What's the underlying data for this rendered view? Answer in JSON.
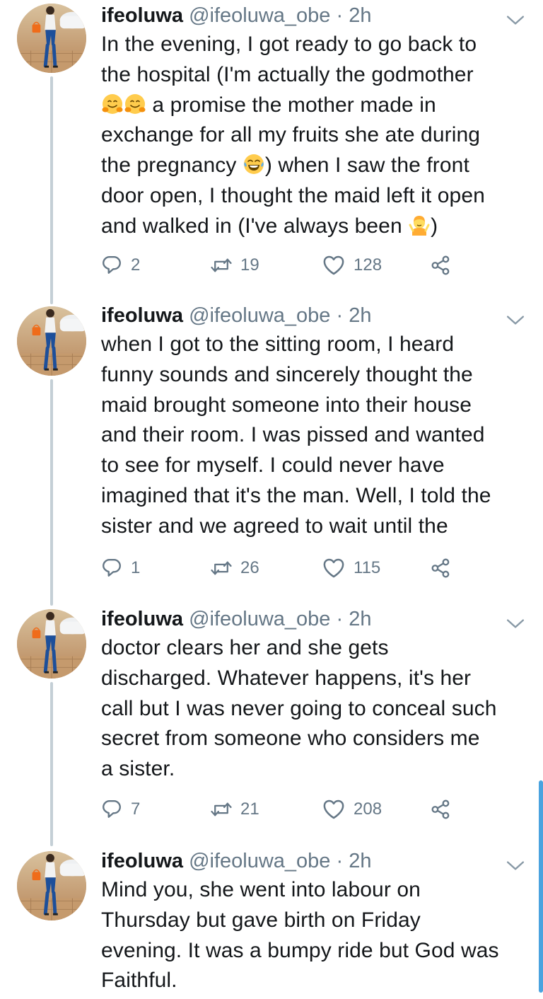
{
  "tweets": [
    {
      "name": "ifeoluwa",
      "handle": "@ifeoluwa_obe",
      "separator": "·",
      "time": "2h",
      "segments": [
        {
          "t": "In the evening, I got ready to go back to\nthe hospital (I'm actually the godmother\n"
        },
        {
          "emoji": "hugging-face"
        },
        {
          "emoji": "hugging-face"
        },
        {
          "t": " a promise the mother made in\nexchange for all my fruits she ate during\nthe pregnancy "
        },
        {
          "emoji": "tears-of-joy"
        },
        {
          "t": ") when I saw the front\ndoor open, I thought the maid left it open\nand walked in (I've always been "
        },
        {
          "emoji": "shrug"
        },
        {
          "t": ")"
        }
      ],
      "replies": "2",
      "retweets": "19",
      "likes": "128"
    },
    {
      "name": "ifeoluwa",
      "handle": "@ifeoluwa_obe",
      "separator": "·",
      "time": "2h",
      "segments": [
        {
          "t": "when I got to the sitting room, I heard\nfunny sounds and sincerely thought the\nmaid brought someone into their house\nand their room. I was pissed and wanted\nto see for myself. I could never have\nimagined that it's the man. Well, I told the\nsister and we agreed to wait until the"
        }
      ],
      "replies": "1",
      "retweets": "26",
      "likes": "115"
    },
    {
      "name": "ifeoluwa",
      "handle": "@ifeoluwa_obe",
      "separator": "·",
      "time": "2h",
      "segments": [
        {
          "t": "doctor clears her and she gets\ndischarged. Whatever happens, it's her\ncall but I was never going to conceal such\nsecret from someone who considers me\na sister."
        }
      ],
      "replies": "7",
      "retweets": "21",
      "likes": "208"
    },
    {
      "name": "ifeoluwa",
      "handle": "@ifeoluwa_obe",
      "separator": "·",
      "time": "2h",
      "segments": [
        {
          "t": "Mind you, she went into labour on\nThursday but gave birth on Friday\nevening. It was a bumpy ride but God was\nFaithful."
        }
      ]
    }
  ],
  "icons": {
    "reply": "reply-icon",
    "retweet": "retweet-icon",
    "like": "like-icon",
    "share": "share-icon",
    "caret": "chevron-down-icon"
  },
  "colors": {
    "secondary_text": "#657786",
    "primary_text": "#14171a",
    "thread_line": "#c4cfd6",
    "scroll_indicator": "#4aa3df"
  }
}
